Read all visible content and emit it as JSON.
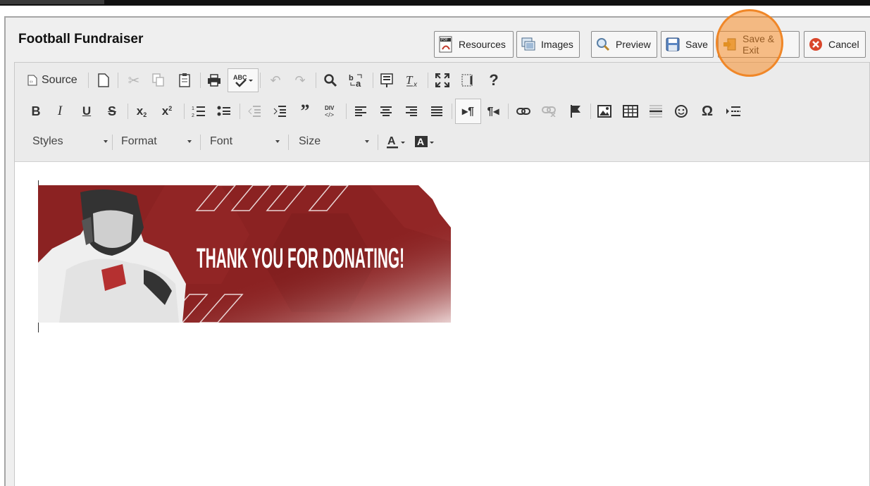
{
  "page": {
    "title": "Football Fundraiser"
  },
  "actions": {
    "resources": "Resources",
    "images": "Images",
    "preview": "Preview",
    "save": "Save",
    "save_exit": "Save & Exit",
    "cancel": "Cancel"
  },
  "toolbar": {
    "source": "Source",
    "styles": "Styles",
    "format": "Format",
    "font": "Font",
    "size": "Size"
  },
  "banner": {
    "text": "THANK YOU FOR DONATING!",
    "accent": "#8b2222"
  },
  "colors": {
    "highlight": "#f58c28",
    "cancel_icon": "#d9462b"
  }
}
